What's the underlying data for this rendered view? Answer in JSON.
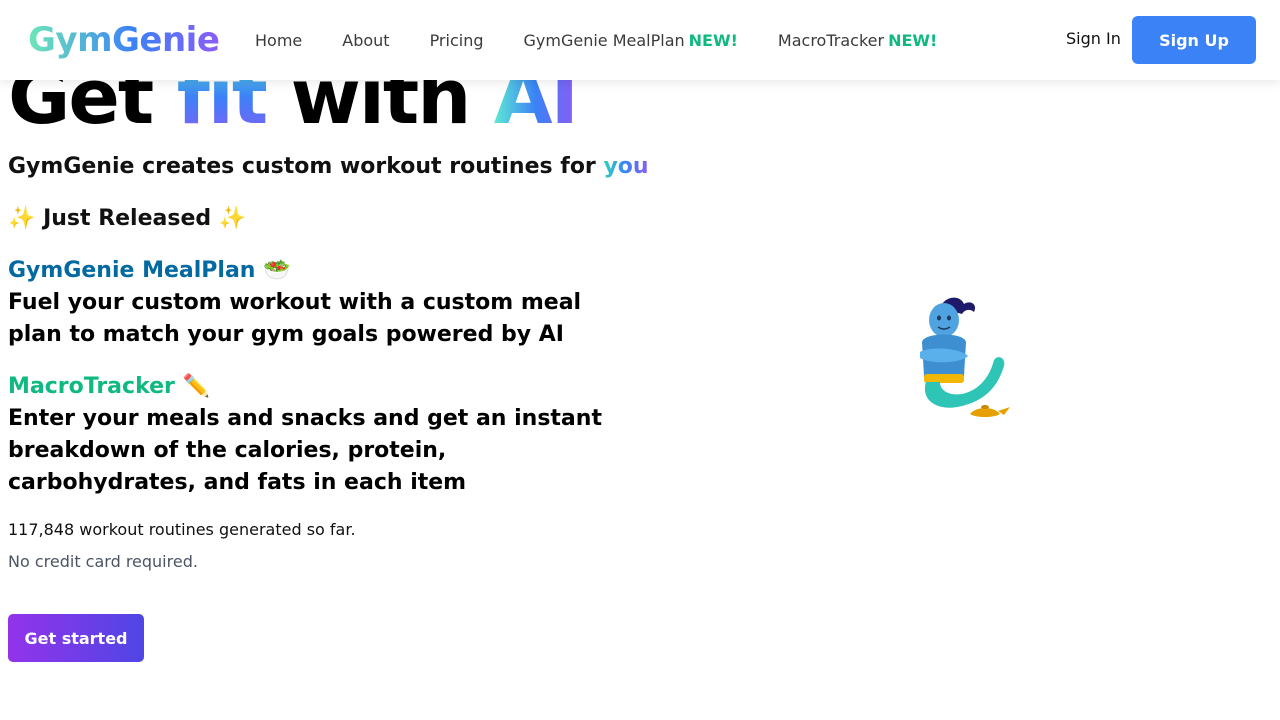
{
  "nav": {
    "logo": "GymGenie",
    "links": [
      {
        "label": "Home"
      },
      {
        "label": "About"
      },
      {
        "label": "Pricing"
      },
      {
        "label": "GymGenie MealPlan",
        "badge": "NEW!"
      },
      {
        "label": "MacroTracker",
        "badge": "NEW!"
      }
    ],
    "signin": "Sign In",
    "signup": "Sign Up"
  },
  "hero": {
    "title_part1": "Get ",
    "title_part2": "fit",
    "title_part3": " with ",
    "title_part4": "AI",
    "subtitle_main": "GymGenie creates custom workout routines for ",
    "subtitle_highlight": "you",
    "released": "Just Released",
    "sparkle": "✨"
  },
  "features": {
    "mealplan": {
      "title": "GymGenie MealPlan",
      "emoji": "🥗",
      "desc": "Fuel your custom workout with a custom meal plan to match your gym goals powered by AI"
    },
    "macro": {
      "title": "MacroTracker",
      "emoji": "✏️",
      "desc": "Enter your meals and snacks and get an instant breakdown of the calories, protein, carbohydrates, and fats in each item"
    }
  },
  "stats": {
    "counter": "117,848 workout routines generated so far.",
    "nocard": "No credit card required."
  },
  "cta": {
    "label": "Get started"
  },
  "colors": {
    "primary_blue": "#3b82f6",
    "accent_green": "#10b981",
    "mealplan_blue": "#0369a1",
    "cta_purple": "#9333ea",
    "genie_skin": "#4fa3e0"
  },
  "illustration": "genie-emoji"
}
